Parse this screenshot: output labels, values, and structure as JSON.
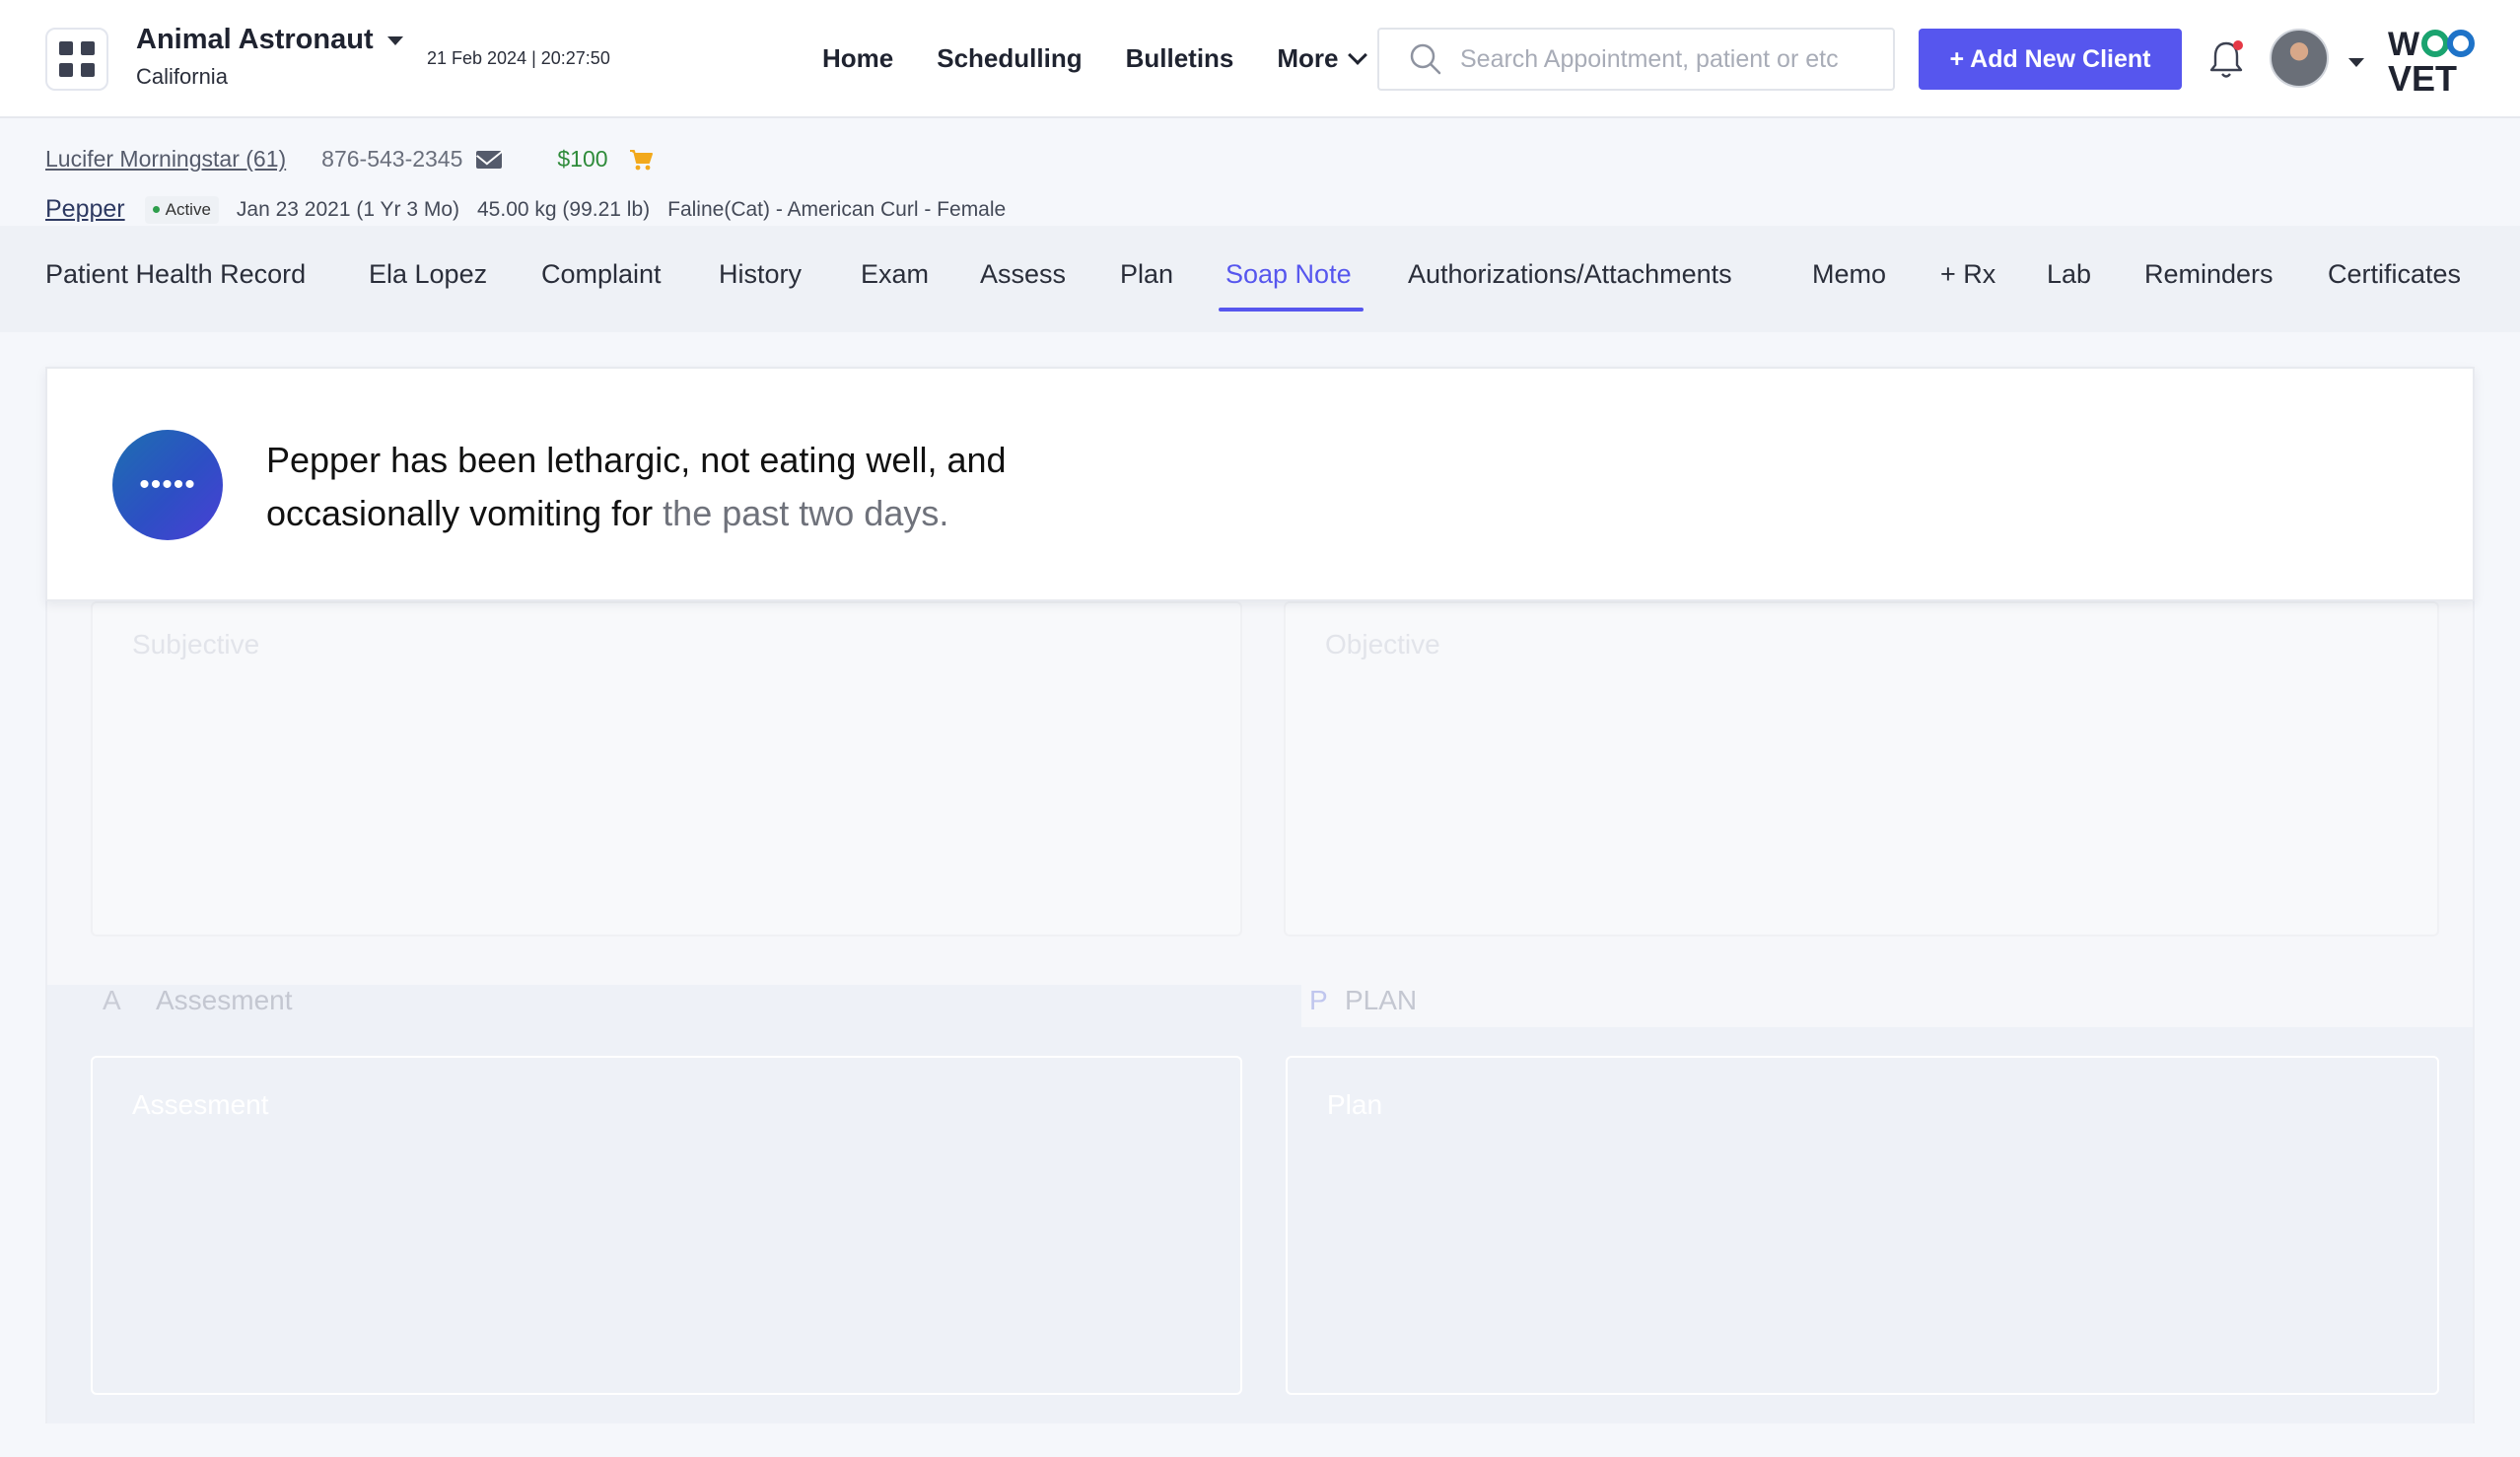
{
  "header": {
    "clinic_name": "Animal Astronaut",
    "clinic_location": "California",
    "datetime": "21 Feb 2024 | 20:27:50",
    "nav": {
      "home": "Home",
      "scheduling": "Schedulling",
      "bulletins": "Bulletins",
      "more": "More"
    },
    "search_placeholder": "Search Appointment, patient or etc",
    "add_client_label": "+ Add New Client",
    "logo_line1": "WOO",
    "logo_line2": "VET"
  },
  "client": {
    "name": "Lucifer Morningstar (61)",
    "phone": "876-543-2345",
    "balance": "$100"
  },
  "patient": {
    "name": "Pepper",
    "status": "Active",
    "dob": "Jan 23 2021 (1 Yr 3 Mo)",
    "weight": "45.00 kg (99.21 lb)",
    "species": "Faline(Cat) - American Curl - Female"
  },
  "tabs": [
    "Patient Health Record",
    "Ela Lopez",
    "Complaint",
    "History",
    "Exam",
    "Assess",
    "Plan",
    "Soap Note",
    "Authorizations/Attachments",
    "Memo",
    "+ Rx",
    "Lab",
    "Reminders",
    "Certificates"
  ],
  "active_tab": "Soap Note",
  "ai_summary": {
    "badge": "•••••",
    "text_main": "Pepper has been lethargic, not eating well, and occasionally vomiting for",
    "text_dim": " the past two days."
  },
  "soap": {
    "subjective_placeholder": "Subjective",
    "objective_placeholder": "Objective",
    "assessment_letter": "A",
    "assessment_title": "Assesment",
    "assessment_placeholder": "Assesment",
    "plan_letter": "P",
    "plan_title": "PLAN",
    "plan_placeholder": "Plan"
  },
  "colors": {
    "accent": "#5656ee",
    "balance": "#2e8b3a",
    "cart": "#f2a91c"
  }
}
